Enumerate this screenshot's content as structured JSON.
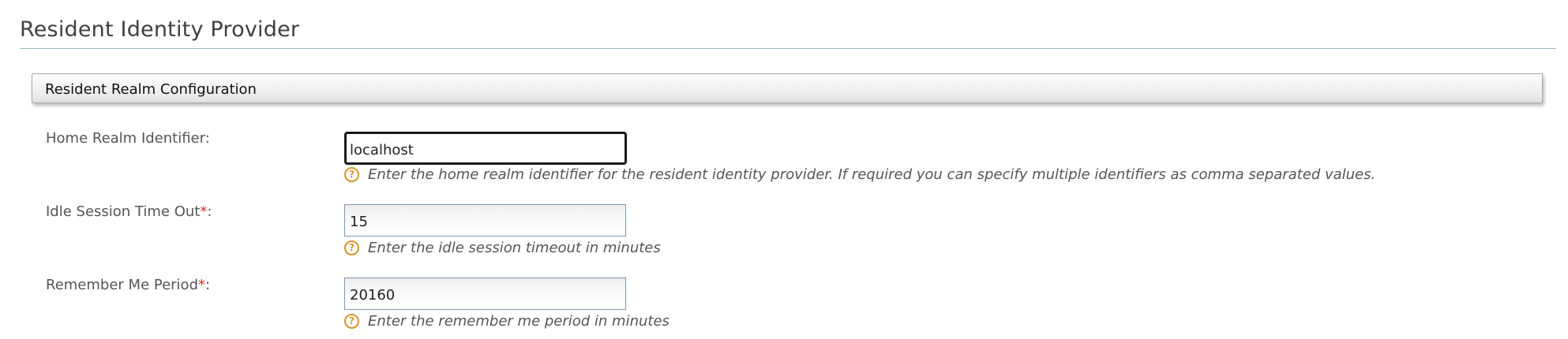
{
  "page": {
    "title": "Resident Identity Provider"
  },
  "section": {
    "title": "Resident Realm Configuration"
  },
  "fields": {
    "home_realm": {
      "label": "Home Realm Identifier:",
      "value": "localhost",
      "help": "Enter the home realm identifier for the resident identity provider. If required you can specify multiple identifiers as comma separated values."
    },
    "idle_timeout": {
      "label": "Idle Session Time Out",
      "required_mark": "*",
      "suffix": ":",
      "value": "15",
      "help": "Enter the idle session timeout in minutes"
    },
    "remember_me": {
      "label": "Remember Me Period",
      "required_mark": "*",
      "suffix": ":",
      "value": "20160",
      "help": "Enter the remember me period in minutes"
    }
  },
  "icons": {
    "help_glyph": "?",
    "help_icon_name": "help-icon"
  },
  "colors": {
    "help_icon": "#d9952c",
    "required_mark": "#e22d2d",
    "title_rule": "#9cb3c4"
  }
}
